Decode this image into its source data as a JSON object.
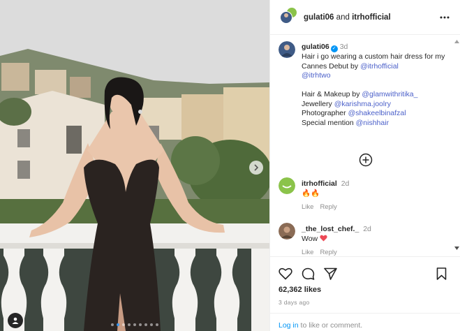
{
  "post": {
    "carousel_dots": 9,
    "active_dot": 1
  },
  "header": {
    "author": "gulati06",
    "joiner": "and",
    "collaborator": "itrhofficial"
  },
  "caption": {
    "username": "gulati06",
    "time": "3d",
    "line1": "Hair i go wearing a custom hair dress for my Cannes Debut by ",
    "mention1": "@itrhofficial",
    "mention2": "@itrhtwo",
    "credit1_label": "Hair & Makeup by ",
    "credit1_mention": "@glamwithritika_",
    "credit2_label": "Jewellery ",
    "credit2_mention": "@karishma.joolry",
    "credit3_label": "Photographer ",
    "credit3_mention": "@shakeelbinafzal",
    "credit4_label": "Special mention ",
    "credit4_mention": "@nishhair"
  },
  "comments": [
    {
      "username": "itrhofficial",
      "time": "2d",
      "text": "🔥🔥",
      "like": "Like",
      "reply": "Reply"
    },
    {
      "username": "_the_lost_chef._",
      "time": "2d",
      "text": "Wow",
      "like": "Like",
      "reply": "Reply"
    }
  ],
  "footer": {
    "likes": "62,362 likes",
    "posted": "3 days ago",
    "login_link": "Log in",
    "login_rest": " to like or comment."
  },
  "colors": {
    "link": "#0095f6",
    "mention": "#4a5fc9",
    "verified": "#0095f6",
    "heart": "#ed4956"
  }
}
